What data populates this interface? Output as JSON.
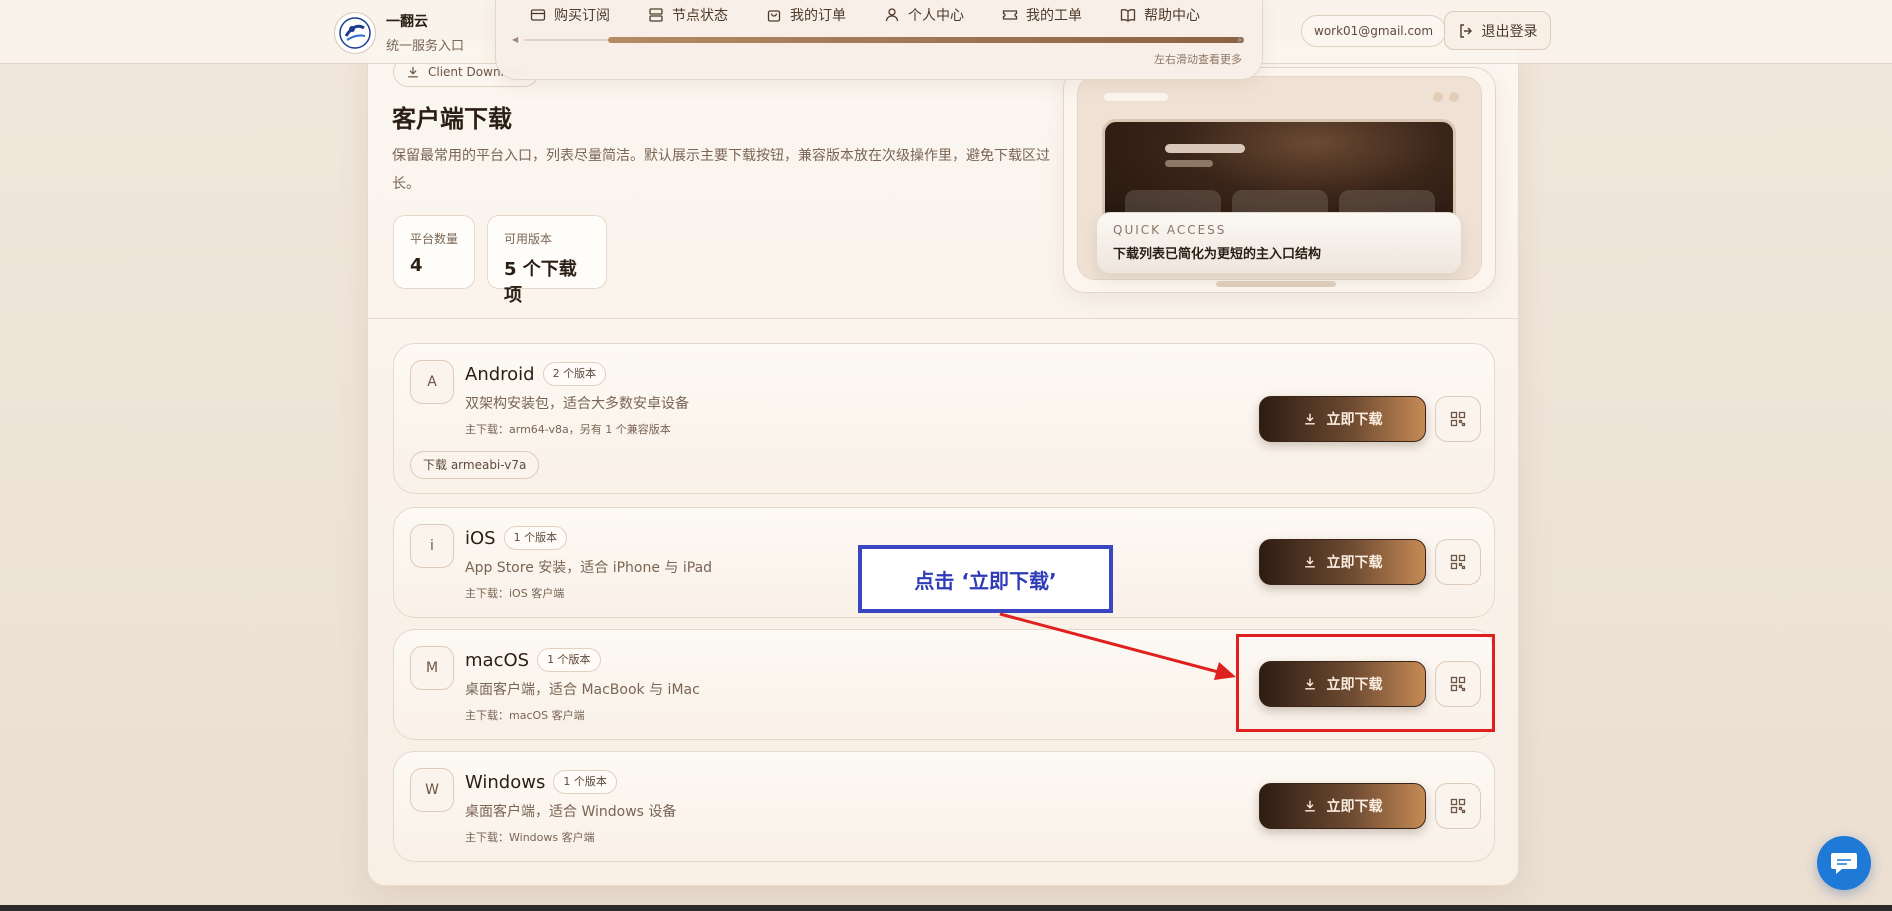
{
  "brand": {
    "name": "一翻云",
    "subtitle": "统一服务入口"
  },
  "nav": {
    "items": [
      {
        "label": "购买订阅",
        "icon": "card-icon"
      },
      {
        "label": "节点状态",
        "icon": "server-icon"
      },
      {
        "label": "我的订单",
        "icon": "bag-icon"
      },
      {
        "label": "个人中心",
        "icon": "user-icon"
      },
      {
        "label": "我的工单",
        "icon": "ticket-icon"
      },
      {
        "label": "帮助中心",
        "icon": "book-icon"
      }
    ],
    "scroll_hint": "左右滑动查看更多"
  },
  "account": {
    "email": "work01@gmail.com",
    "logout_label": "退出登录"
  },
  "hero": {
    "chip_label": "Client Download",
    "title": "客户端下载",
    "description": "保留最常用的平台入口，列表尽量简洁。默认展示主要下载按钮，兼容版本放在次级操作里，避免下载区过长。",
    "stats": [
      {
        "label": "平台数量",
        "value": "4"
      },
      {
        "label": "可用版本",
        "value": "5 个下载项"
      }
    ],
    "preview": {
      "kicker": "QUICK ACCESS",
      "caption": "下载列表已简化为更短的主入口结构"
    }
  },
  "platforms": [
    {
      "letter": "A",
      "name": "Android",
      "badge": "2 个版本",
      "desc": "双架构安装包，适合大多数安卓设备",
      "main": "主下载：arm64-v8a，另有 1 个兼容版本",
      "alt": "下载 armeabi-v7a",
      "button": "立即下载"
    },
    {
      "letter": "i",
      "name": "iOS",
      "badge": "1 个版本",
      "desc": "App Store 安装，适合 iPhone 与 iPad",
      "main": "主下载：iOS 客户端",
      "button": "立即下载"
    },
    {
      "letter": "M",
      "name": "macOS",
      "badge": "1 个版本",
      "desc": "桌面客户端，适合 MacBook 与 iMac",
      "main": "主下载：macOS 客户端",
      "button": "立即下载"
    },
    {
      "letter": "W",
      "name": "Windows",
      "badge": "1 个版本",
      "desc": "桌面客户端，适合 Windows 设备",
      "main": "主下载：Windows 客户端",
      "button": "立即下载"
    }
  ],
  "annotation": {
    "text": "点击 ‘立即下载’",
    "box_color": "#3a45c2",
    "highlight_color": "#e01f1f"
  },
  "colors": {
    "accent_dark": "#2e1c12",
    "accent_light": "#c58a55",
    "background": "#f1e7dc",
    "chat": "#1f79d6"
  }
}
